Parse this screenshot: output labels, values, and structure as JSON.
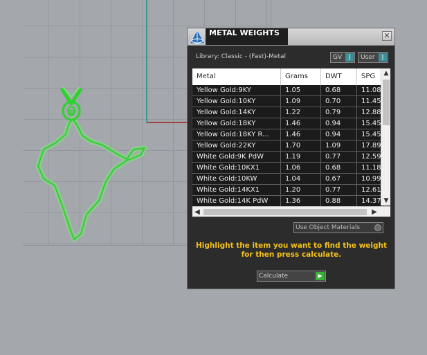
{
  "panel": {
    "title": "METAL WEIGHTS",
    "close_glyph": "✕",
    "library_label": "Library: Classic - (Fast)-Metal",
    "toggles": [
      {
        "label": "GV",
        "icon": "toggle-knob"
      },
      {
        "label": "User",
        "icon": "toggle-knob"
      }
    ],
    "table": {
      "headers": [
        "Metal",
        "Grams",
        "DWT",
        "SPG"
      ],
      "rows": [
        [
          "Yellow Gold:9KY",
          "1.05",
          "0.68",
          "11.08"
        ],
        [
          "Yellow Gold:10KY",
          "1.09",
          "0.70",
          "11.45"
        ],
        [
          "Yellow Gold:14KY",
          "1.22",
          "0.79",
          "12.88"
        ],
        [
          "Yellow Gold:18KY",
          "1.46",
          "0.94",
          "15.45"
        ],
        [
          "Yellow Gold:18KY R...",
          "1.46",
          "0.94",
          "15.45"
        ],
        [
          "Yellow Gold:22KY",
          "1.70",
          "1.09",
          "17.89"
        ],
        [
          "White Gold:9K PdW",
          "1.19",
          "0.77",
          "12.59"
        ],
        [
          "White Gold:10KX1",
          "1.06",
          "0.68",
          "11.18"
        ],
        [
          "White Gold:10KW",
          "1.04",
          "0.67",
          "10.99"
        ],
        [
          "White Gold:14KX1",
          "1.20",
          "0.77",
          "12.61"
        ],
        [
          "White Gold:14K PdW",
          "1.36",
          "0.88",
          "14.37"
        ]
      ]
    },
    "use_object_materials_label": "Use Object Materials",
    "hint": "Highlight the item you want to find the weight for then press calculate.",
    "calculate_label": "Calculate",
    "colors": {
      "hint": "#f3c11c",
      "selection_green": "#36b236",
      "toggle_teal": "#3d8f97"
    }
  }
}
